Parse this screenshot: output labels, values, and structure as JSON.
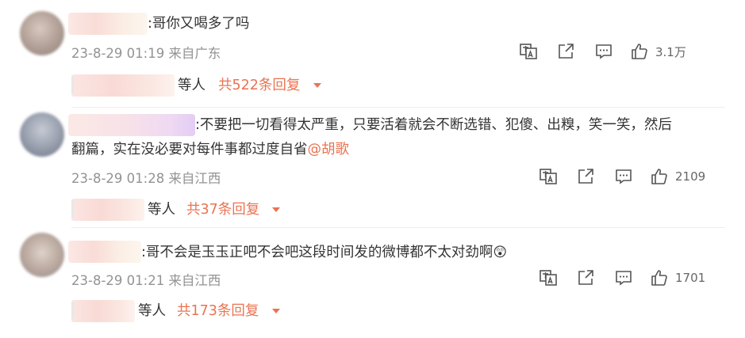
{
  "comments": [
    {
      "text": ":哥你又喝多了吗",
      "meta": "23-8-29 01:19 来自广东",
      "likes": "3.1万",
      "reply_who": "等人",
      "reply_count": "共522条回复"
    },
    {
      "text_line1": ":不要把一切看得太严重，只要活着就会不断选错、犯傻、出糗，笑一笑，然后",
      "text_line2": "翻篇，实在没必要对每件事都过度自省",
      "mention": "@胡歌",
      "meta": "23-8-29 01:28 来自江西",
      "likes": "2109",
      "reply_who": "等人",
      "reply_count": "共37条回复"
    },
    {
      "text": ":哥不会是玉玉正吧不会吧这段时间发的微博都不太对劲啊",
      "emoji": "😲",
      "meta": "23-8-29 01:21 来自江西",
      "likes": "1701",
      "reply_who": "等人",
      "reply_count": "共173条回复"
    }
  ],
  "icons": [
    "translate-icon",
    "share-icon",
    "comment-icon",
    "like-icon",
    "caret-down-icon"
  ],
  "colors": {
    "accent": "#eb7350",
    "meta": "#939393",
    "text": "#333333"
  }
}
